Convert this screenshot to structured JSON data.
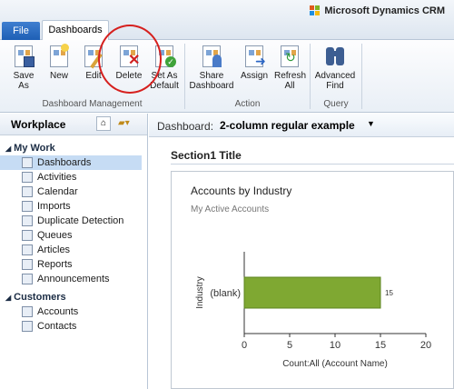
{
  "app": {
    "brand": "Microsoft Dynamics CRM"
  },
  "tabs": {
    "file": "File",
    "dashboards": "Dashboards"
  },
  "ribbon": {
    "buttons": {
      "save_as": "Save As",
      "new": "New",
      "edit": "Edit",
      "delete": "Delete",
      "set_default": "Set As Default",
      "share": "Share Dashboard",
      "assign": "Assign",
      "refresh": "Refresh All",
      "advanced_find": "Advanced Find"
    },
    "groups": {
      "dashboard_management": "Dashboard Management",
      "action": "Action",
      "query": "Query"
    }
  },
  "leftnav": {
    "title": "Workplace",
    "sections": [
      {
        "title": "My Work",
        "items": [
          {
            "label": "Dashboards",
            "icon": "dashboard-icon",
            "selected": true
          },
          {
            "label": "Activities",
            "icon": "activities-icon"
          },
          {
            "label": "Calendar",
            "icon": "calendar-icon"
          },
          {
            "label": "Imports",
            "icon": "imports-icon"
          },
          {
            "label": "Duplicate Detection",
            "icon": "duplicate-icon"
          },
          {
            "label": "Queues",
            "icon": "queues-icon"
          },
          {
            "label": "Articles",
            "icon": "articles-icon"
          },
          {
            "label": "Reports",
            "icon": "reports-icon"
          },
          {
            "label": "Announcements",
            "icon": "announcements-icon"
          }
        ]
      },
      {
        "title": "Customers",
        "items": [
          {
            "label": "Accounts",
            "icon": "accounts-icon"
          },
          {
            "label": "Contacts",
            "icon": "contacts-icon"
          }
        ]
      }
    ]
  },
  "main": {
    "dashboard_label": "Dashboard:",
    "dashboard_name": "2-column regular example",
    "section_title": "Section1 Title",
    "chart_title": "Accounts by Industry",
    "chart_subtitle": "My Active Accounts"
  },
  "chart_data": {
    "type": "bar",
    "orientation": "horizontal",
    "title": "Accounts by Industry",
    "subtitle": "My Active Accounts",
    "categories": [
      "(blank)"
    ],
    "values": [
      15
    ],
    "data_labels": [
      "15"
    ],
    "xlabel": "Count:All (Account Name)",
    "ylabel": "Industry",
    "xlim": [
      0,
      20
    ],
    "xticks": [
      0,
      5,
      10,
      15,
      20
    ],
    "bar_color": "#7fa832"
  },
  "colors": {
    "accent": "#1e5fb5",
    "selection": "#c6dcf4",
    "highlight_circle": "#d6201e"
  }
}
